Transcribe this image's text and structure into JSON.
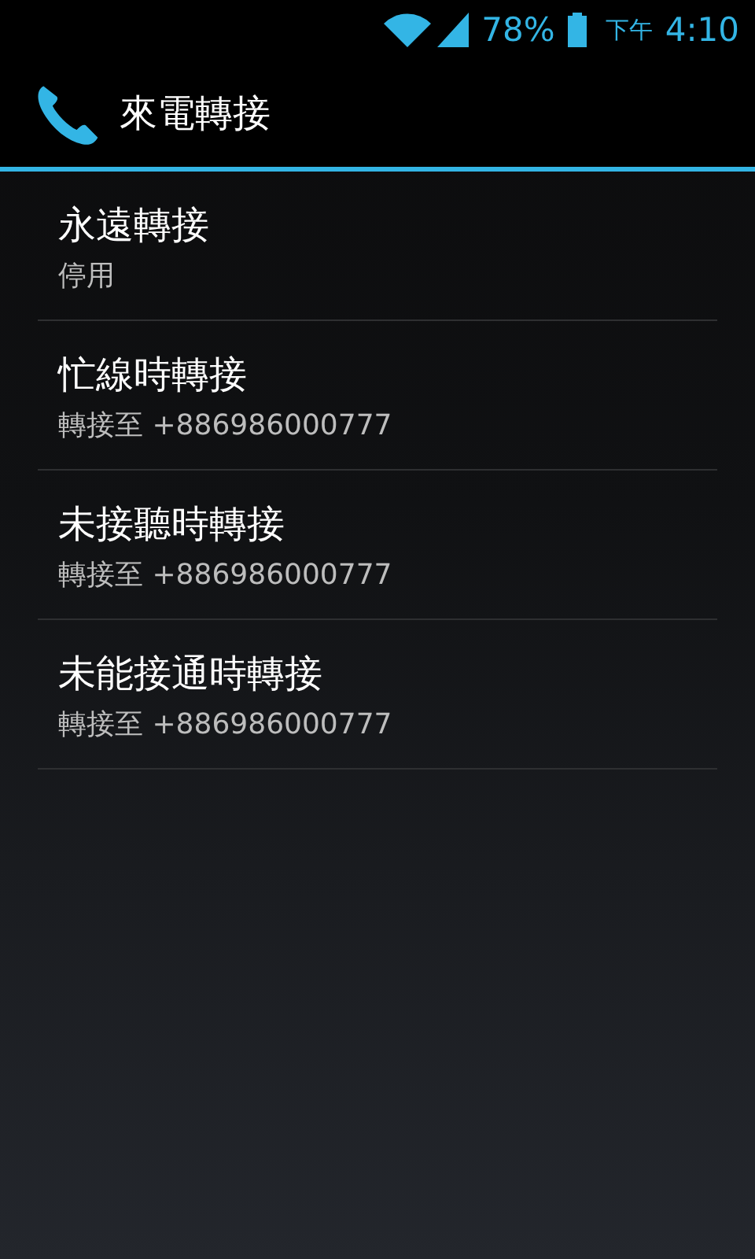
{
  "status_bar": {
    "battery": "78%",
    "ampm": "下午",
    "time": "4:10"
  },
  "action_bar": {
    "title": "來電轉接"
  },
  "items": [
    {
      "title": "永遠轉接",
      "summary": "停用"
    },
    {
      "title": "忙線時轉接",
      "summary": "轉接至 +886986000777"
    },
    {
      "title": "未接聽時轉接",
      "summary": "轉接至 +886986000777"
    },
    {
      "title": "未能接通時轉接",
      "summary": "轉接至 +886986000777"
    }
  ]
}
